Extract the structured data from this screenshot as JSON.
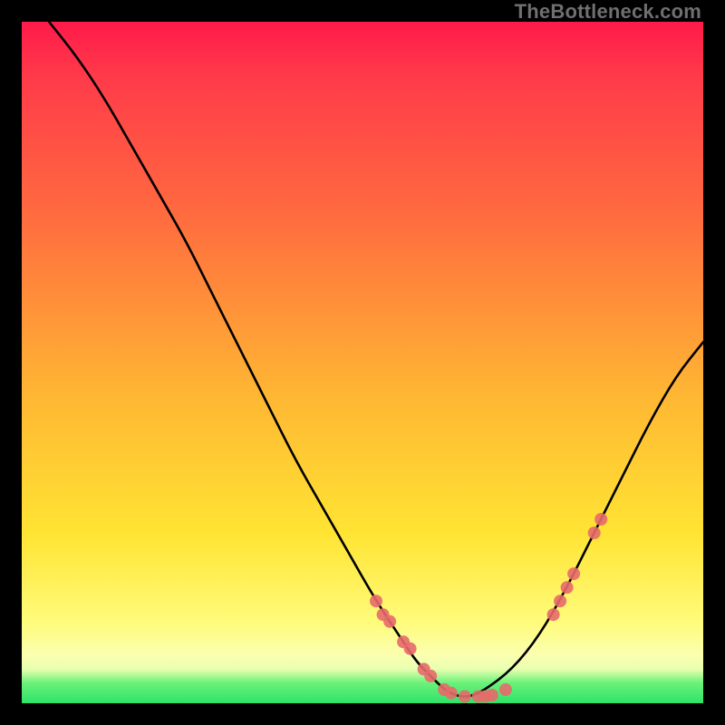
{
  "watermark": "TheBottleneck.com",
  "chart_data": {
    "type": "line",
    "title": "",
    "xlabel": "",
    "ylabel": "",
    "xlim": [
      0,
      100
    ],
    "ylim": [
      0,
      100
    ],
    "grid": false,
    "legend": false,
    "series": [
      {
        "name": "bottleneck-curve",
        "x": [
          4,
          8,
          12,
          16,
          20,
          24,
          28,
          32,
          36,
          40,
          44,
          48,
          52,
          56,
          58,
          60,
          62,
          64,
          66,
          68,
          72,
          76,
          80,
          84,
          88,
          92,
          96,
          100
        ],
        "y": [
          100,
          95,
          89,
          82,
          75,
          68,
          60,
          52,
          44,
          36,
          29,
          22,
          15,
          9,
          6,
          4,
          2,
          1,
          1,
          2,
          5,
          10,
          17,
          25,
          33,
          41,
          48,
          53
        ]
      }
    ],
    "scatter_points": {
      "name": "highlighted-points",
      "x": [
        52,
        53,
        54,
        56,
        57,
        59,
        60,
        62,
        63,
        65,
        67,
        68,
        69,
        71,
        78,
        79,
        80,
        81,
        84,
        85
      ],
      "y": [
        15,
        13,
        12,
        9,
        8,
        5,
        4,
        2,
        1.5,
        1,
        1,
        1,
        1.2,
        2,
        13,
        15,
        17,
        19,
        25,
        27
      ]
    },
    "gradient_stops": [
      {
        "pos": 0,
        "color": "#ff1a4a"
      },
      {
        "pos": 8,
        "color": "#ff3a4a"
      },
      {
        "pos": 28,
        "color": "#ff6a3f"
      },
      {
        "pos": 55,
        "color": "#ffb733"
      },
      {
        "pos": 75,
        "color": "#ffe433"
      },
      {
        "pos": 88,
        "color": "#fffb7a"
      },
      {
        "pos": 93,
        "color": "#fbffb0"
      },
      {
        "pos": 95,
        "color": "#e8ffb0"
      },
      {
        "pos": 97,
        "color": "#6cf27a"
      },
      {
        "pos": 100,
        "color": "#2de36a"
      }
    ]
  }
}
